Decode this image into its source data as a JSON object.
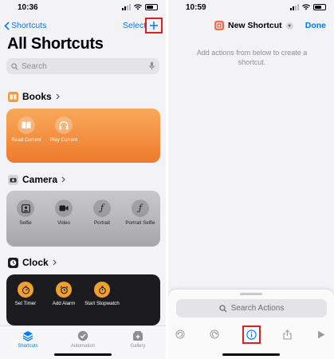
{
  "left": {
    "time": "10:36",
    "nav": {
      "back_label": "Shortcuts",
      "select_label": "Select",
      "add_icon": "plus-icon"
    },
    "title": "All Shortcuts",
    "search": {
      "placeholder": "Search"
    },
    "sections": {
      "books": {
        "label": "Books",
        "color": "#f19a40",
        "actions": [
          {
            "label": "Read Current",
            "icon": "book-icon"
          },
          {
            "label": "Play Current",
            "icon": "headphones-icon"
          }
        ]
      },
      "camera": {
        "label": "Camera",
        "color": "#b8b8bc",
        "actions": [
          {
            "label": "Selfie",
            "icon": "selfie-icon"
          },
          {
            "label": "Video",
            "icon": "video-camera-icon"
          },
          {
            "label": "Portrait",
            "icon": "function-icon"
          },
          {
            "label": "Portrait Selfie",
            "icon": "function-icon"
          }
        ]
      },
      "clock": {
        "label": "Clock",
        "color": "#1c1c1e",
        "actions": [
          {
            "label": "Set Timer",
            "icon": "timer-icon"
          },
          {
            "label": "Add Alarm",
            "icon": "alarm-icon"
          },
          {
            "label": "Start Stopwatch",
            "icon": "stopwatch-icon"
          }
        ]
      }
    },
    "tabbar": [
      {
        "label": "Shortcuts",
        "active": true
      },
      {
        "label": "Automation",
        "active": false
      },
      {
        "label": "Gallery",
        "active": false
      }
    ]
  },
  "right": {
    "time": "10:59",
    "title": "New Shortcut",
    "done_label": "Done",
    "hint": "Add actions from below to create a shortcut.",
    "search_actions": "Search Actions",
    "toolbar_icons": [
      "undo-icon",
      "redo-icon",
      "info-icon",
      "share-icon",
      "play-icon"
    ]
  },
  "colors": {
    "accent": "#007aff",
    "highlight": "#e02020"
  }
}
